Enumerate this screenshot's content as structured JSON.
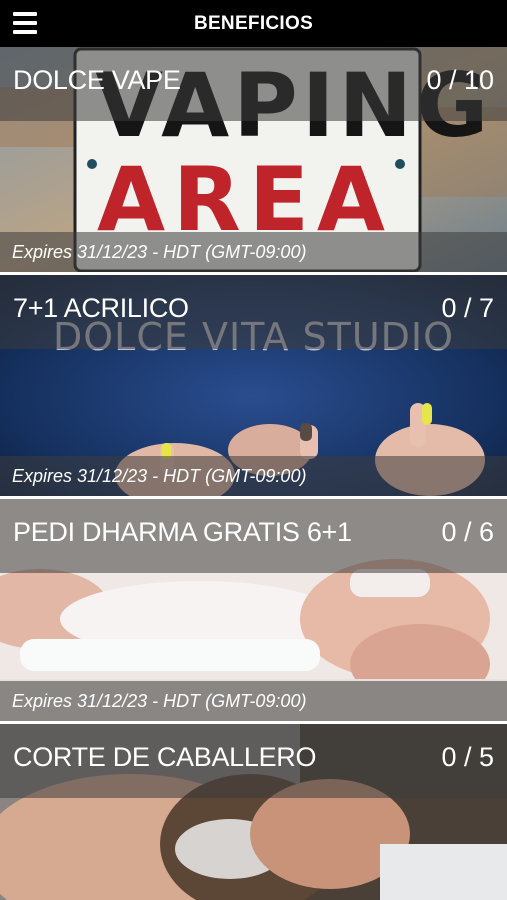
{
  "header": {
    "title": "BENEFICIOS",
    "menu_icon": "hamburger-menu-icon"
  },
  "cards": [
    {
      "name": "DOLCE VAPE",
      "count": "0 / 10",
      "expires": "Expires 31/12/23 - HDT (GMT-09:00)",
      "image_text": [
        "VAPING",
        "AREA"
      ]
    },
    {
      "name": "7+1 ACRILICO",
      "count": "0 / 7",
      "expires": "Expires 31/12/23 - HDT (GMT-09:00)",
      "image_text": [
        "DOLCE VITA STUDIO"
      ]
    },
    {
      "name": "PEDI DHARMA GRATIS 6+1",
      "count": "0 / 6",
      "expires": "Expires 31/12/23 - HDT (GMT-09:00)"
    },
    {
      "name": "CORTE DE CABALLERO",
      "count": "0 / 5"
    }
  ]
}
